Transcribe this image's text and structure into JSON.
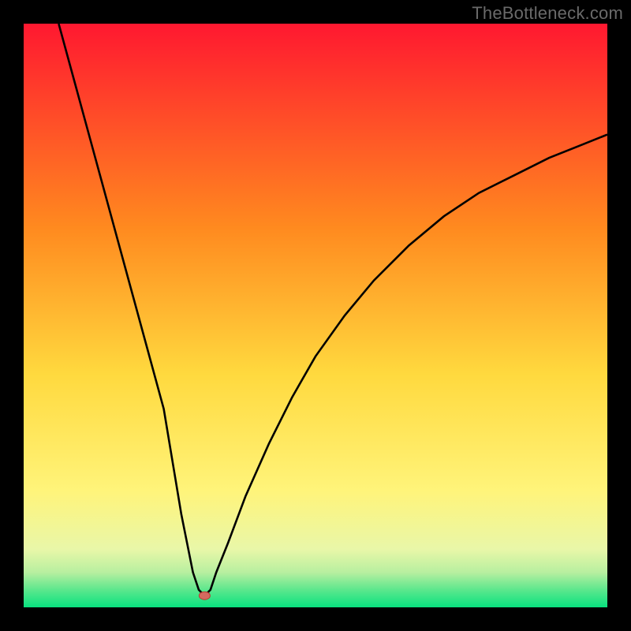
{
  "watermark": "TheBottleneck.com",
  "colors": {
    "frame": "#000000",
    "watermark": "#6a6a6a",
    "curve": "#000000",
    "marker_fill": "#d46a5f",
    "marker_stroke": "#b63e33",
    "gradient_top": "#ff1830",
    "gradient_mid_upper": "#ff8a1f",
    "gradient_mid": "#ffd93e",
    "gradient_mid_lower": "#fff47a",
    "gradient_green1": "#e9f7a8",
    "gradient_green2": "#b8efa0",
    "gradient_green3": "#5ce78d",
    "gradient_bottom": "#08e27f"
  },
  "chart_data": {
    "type": "line",
    "title": "",
    "xlabel": "",
    "ylabel": "",
    "xlim": [
      0,
      100
    ],
    "ylim": [
      0,
      100
    ],
    "grid": false,
    "legend": false,
    "annotations": [],
    "marker": {
      "x": 31,
      "y": 2
    },
    "series": [
      {
        "name": "curve",
        "x": [
          6,
          9,
          12,
          15,
          18,
          21,
          24,
          26,
          27,
          28,
          29,
          30,
          31,
          32,
          33,
          35,
          38,
          42,
          46,
          50,
          55,
          60,
          66,
          72,
          78,
          84,
          90,
          95,
          100
        ],
        "y": [
          100,
          89,
          78,
          67,
          56,
          45,
          34,
          22,
          16,
          11,
          6,
          3,
          2,
          3,
          6,
          11,
          19,
          28,
          36,
          43,
          50,
          56,
          62,
          67,
          71,
          74,
          77,
          79,
          81
        ]
      }
    ]
  }
}
